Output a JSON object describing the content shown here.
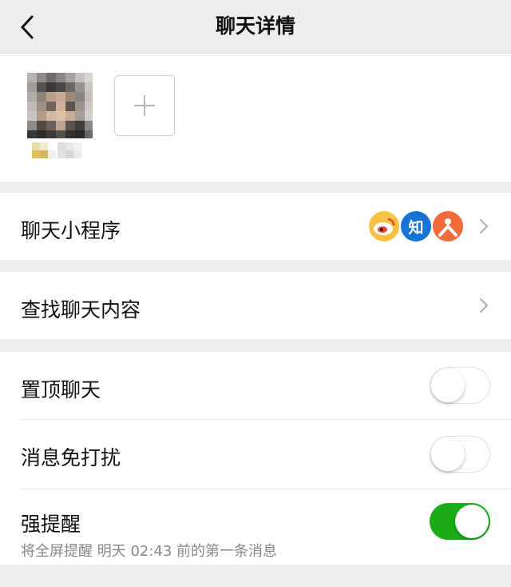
{
  "nav": {
    "back_icon": "chevron-left-icon",
    "title": "聊天详情"
  },
  "members": {
    "add_icon": "plus-icon"
  },
  "mini_programs": {
    "label": "聊天小程序",
    "icons": [
      {
        "name": "weibo-icon",
        "text": "",
        "color": "#f5c242"
      },
      {
        "name": "zhihu-icon",
        "text": "知",
        "color": "#1772d6"
      },
      {
        "name": "mini-program-icon",
        "text": "",
        "color": "#f26b3a"
      }
    ]
  },
  "search": {
    "label": "查找聊天内容"
  },
  "settings": {
    "pin_label": "置顶聊天",
    "pin_on": false,
    "mute_label": "消息免打扰",
    "mute_on": false,
    "remind_label": "强提醒",
    "remind_on": true,
    "remind_sub": "将全屏提醒 明天 02:43 前的第一条消息"
  },
  "colors": {
    "accent": "#1aad19",
    "background": "#ededed"
  }
}
